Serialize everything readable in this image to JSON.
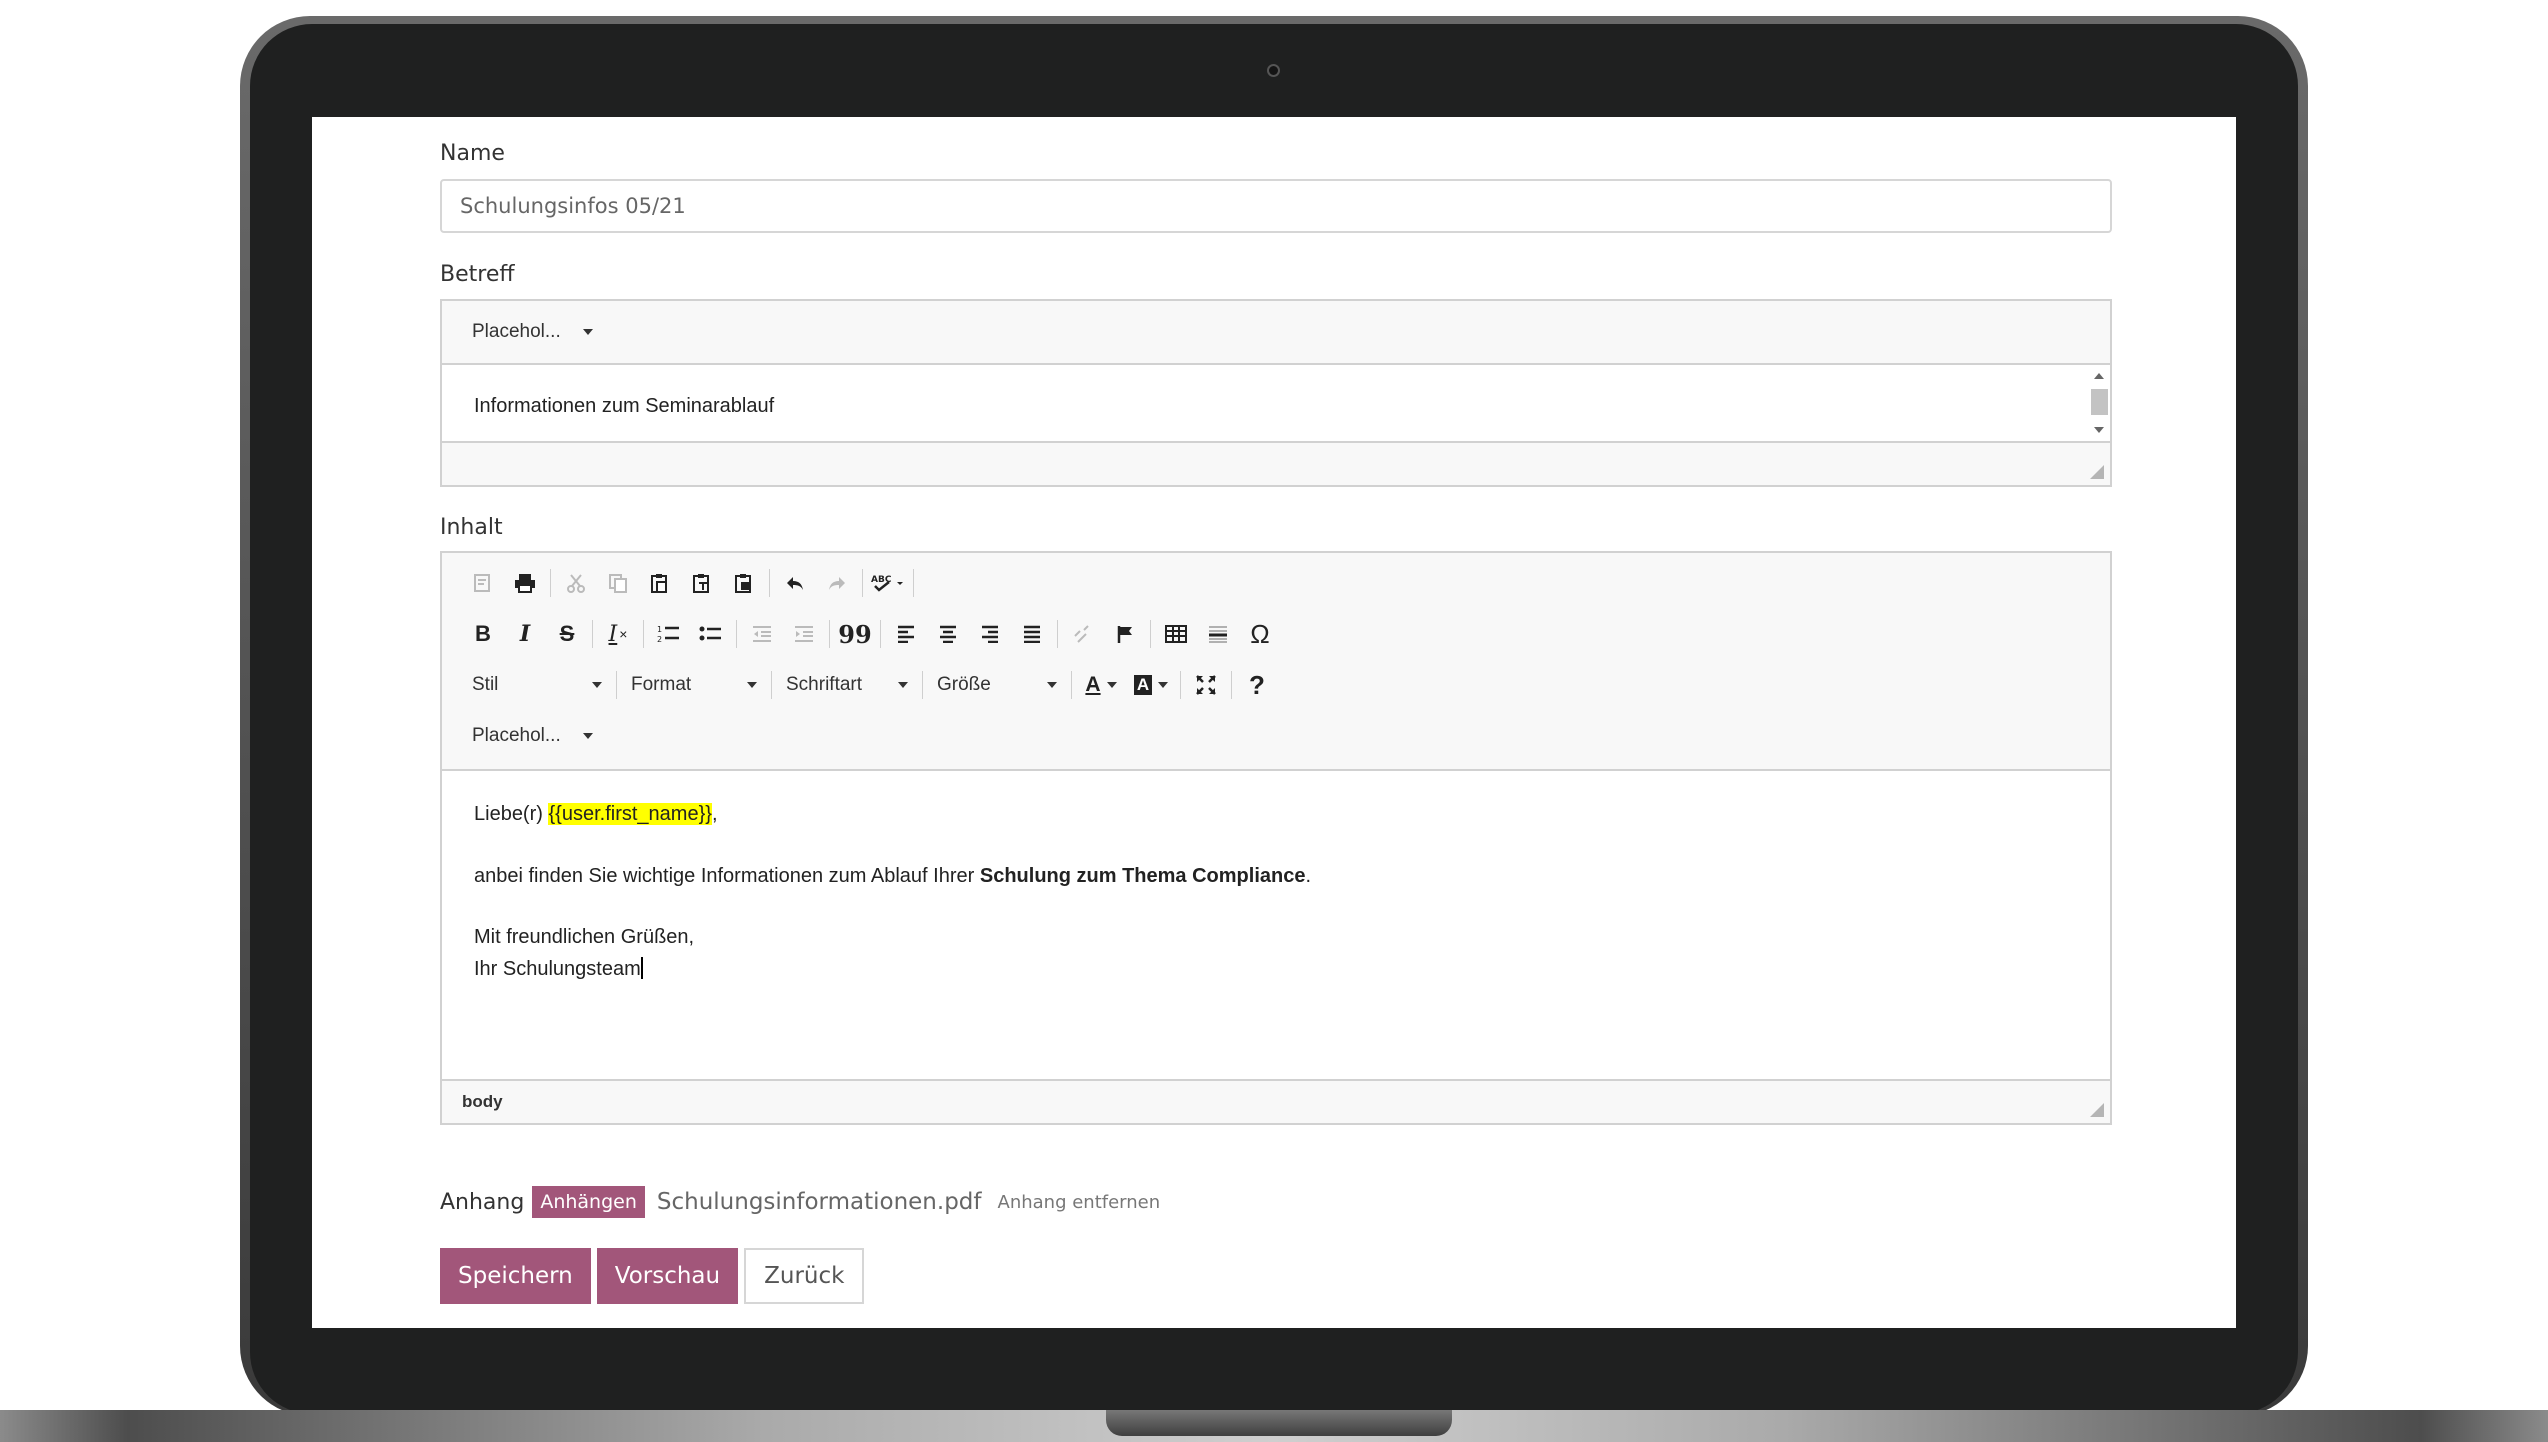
{
  "form": {
    "name_label": "Name",
    "name_value": "Schulungsinfos 05/21",
    "subject_label": "Betreff",
    "subject_placeholder_dropdown": "Placehol...",
    "subject_value": "Informationen zum Seminarablauf",
    "content_label": "Inhalt",
    "toolbar": {
      "row1": [
        "templates-icon",
        "print-icon",
        "cut-icon",
        "copy-icon",
        "paste-icon",
        "paste-text-icon",
        "paste-word-icon",
        "undo-icon",
        "redo-icon",
        "spellcheck-icon"
      ],
      "bold": "B",
      "italic": "I",
      "strike": "S",
      "remove_format": "I",
      "blockquote": "99",
      "special_char": "Ω",
      "help": "?",
      "style_dropdown": "Stil",
      "format_dropdown": "Format",
      "font_dropdown": "Schriftart",
      "size_dropdown": "Größe",
      "text_color": "A",
      "bg_color": "A",
      "placeholder_dropdown": "Placehol..."
    },
    "content": {
      "greeting_prefix": "Liebe(r) ",
      "greeting_placeholder": "{{user.first_name}}",
      "greeting_suffix": ",",
      "line2_prefix": "anbei finden Sie wichtige Informationen zum Ablauf Ihrer ",
      "line2_bold": "Schulung zum Thema Compliance",
      "line2_suffix": ".",
      "closing": "Mit freundlichen Grüßen,",
      "signature": "Ihr Schulungsteam"
    },
    "status_path": "body",
    "attachment_label": "Anhang",
    "attach_button": "Anhängen",
    "attachment_file": "Schulungsinformationen.pdf",
    "remove_attachment": "Anhang entfernen",
    "save_button": "Speichern",
    "preview_button": "Vorschau",
    "back_button": "Zurück"
  },
  "colors": {
    "accent": "#a2567a",
    "highlight": "#ffff00"
  }
}
